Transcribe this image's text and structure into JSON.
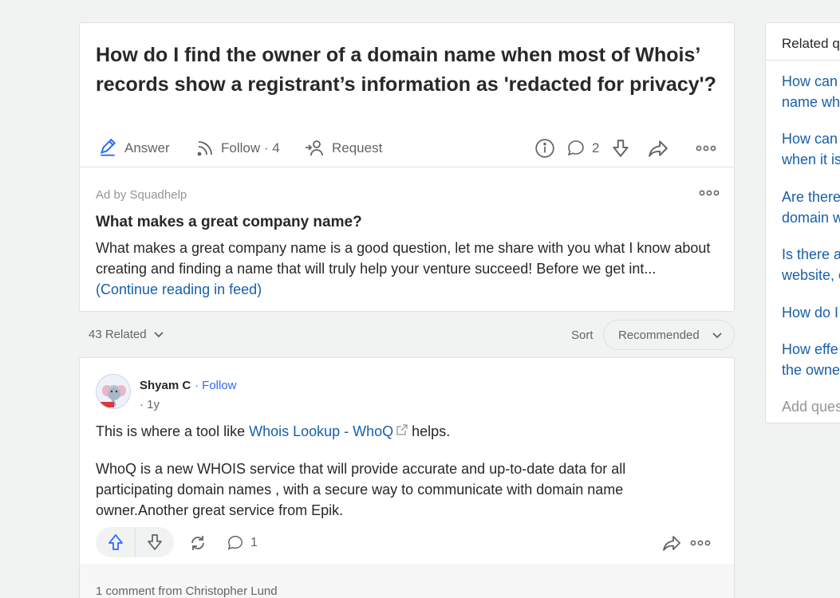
{
  "question": {
    "title": "How do I find the owner of a domain name when most of Whois’ records show a registrant’s information as 'redacted for privacy'?",
    "answer_label": "Answer",
    "follow_label": "Follow · 4",
    "request_label": "Request",
    "comment_count": "2"
  },
  "ad": {
    "label": "Ad by Squadhelp",
    "title": "What makes a great company name?",
    "body": "What makes a great company name is a good question, let me share with you what I know about creating and finding a name that will truly help your venture succeed! Before we get int...",
    "continue_link": "(Continue reading in feed)"
  },
  "related_bar": {
    "count_label": "43 Related",
    "sort_label": "Sort",
    "sort_value": "Recommended"
  },
  "answer": {
    "author": "Shyam C",
    "follow": "· Follow",
    "time": "· 1y",
    "p1_before": "This is where a tool like ",
    "p1_link": "Whois Lookup - WhoQ",
    "p1_after": " helps.",
    "p2": "WhoQ is a new WHOIS service that will provide accurate and up-to-date data for all participating domain names , with a secure way to communicate with domain name owner.Another great service from Epik.",
    "comment_count": "1",
    "comment_from": "1 comment from Christopher Lund"
  },
  "sidebar": {
    "title": "Related q",
    "items": [
      {
        "line1": "How can",
        "line2": "name wh"
      },
      {
        "line1": "How can",
        "line2": "when it is"
      },
      {
        "line1": "Are there",
        "line2": "domain w"
      },
      {
        "line1": "Is there a",
        "line2": "website, c"
      },
      {
        "line1": "How do I",
        "line2": ""
      },
      {
        "line1": "How effe",
        "line2": "the owne"
      }
    ],
    "add_label": "Add ques"
  }
}
